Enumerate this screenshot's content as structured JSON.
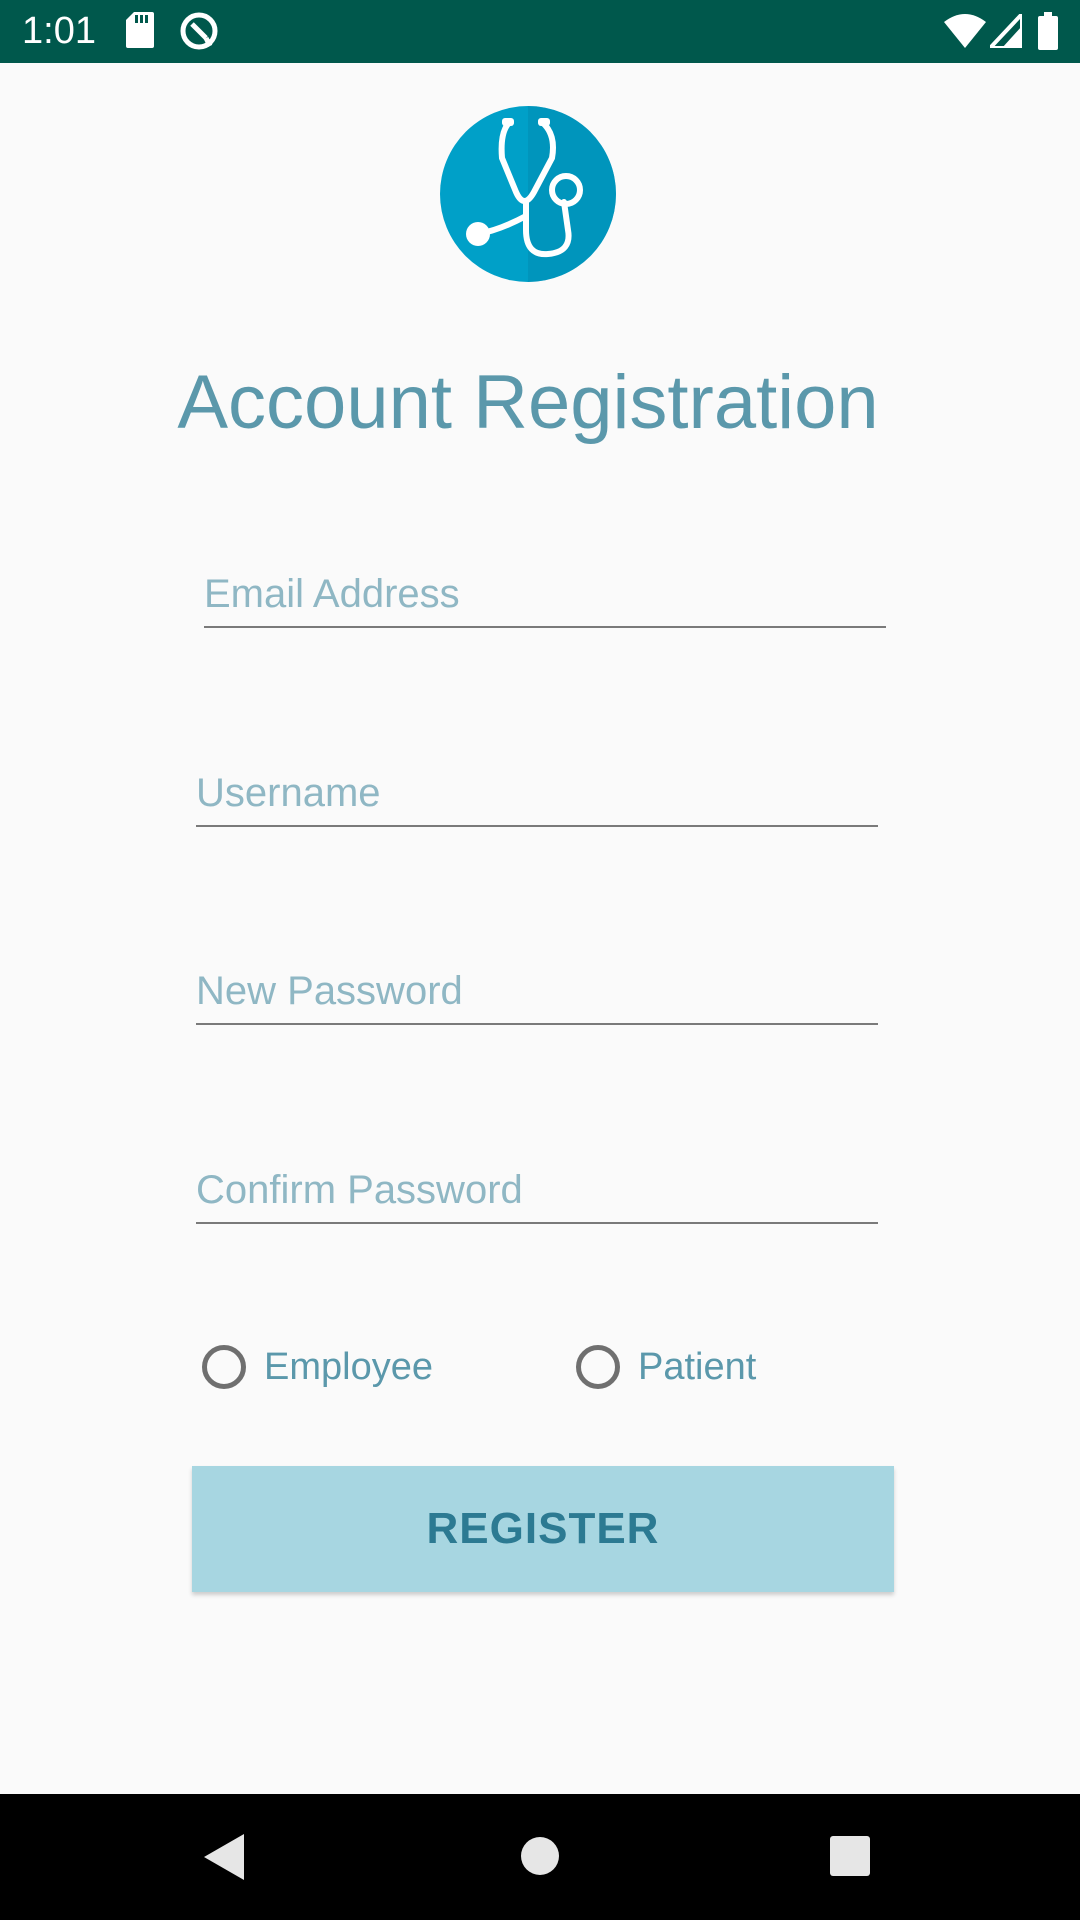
{
  "status_bar": {
    "time": "1:01",
    "icons": [
      "sd-card-icon",
      "data-saver-icon",
      "wifi-icon",
      "signal-icon",
      "battery-icon"
    ],
    "background": "#00584c"
  },
  "logo": {
    "icon": "stethoscope-icon",
    "color": "#00a0c8"
  },
  "title": "Account Registration",
  "form": {
    "email_placeholder": "Email Address",
    "username_placeholder": "Username",
    "new_password_placeholder": "New Password",
    "confirm_password_placeholder": "Confirm Password",
    "role_options": [
      {
        "label": "Employee",
        "selected": false
      },
      {
        "label": "Patient",
        "selected": false
      }
    ],
    "register_label": "REGISTER"
  },
  "nav_bar": {
    "buttons": [
      "back-icon",
      "home-icon",
      "recents-icon"
    ]
  },
  "colors": {
    "accent": "#5b98ab",
    "button_bg": "#a7d6e1",
    "button_text": "#2c7a92",
    "placeholder": "#8fb7c4"
  }
}
